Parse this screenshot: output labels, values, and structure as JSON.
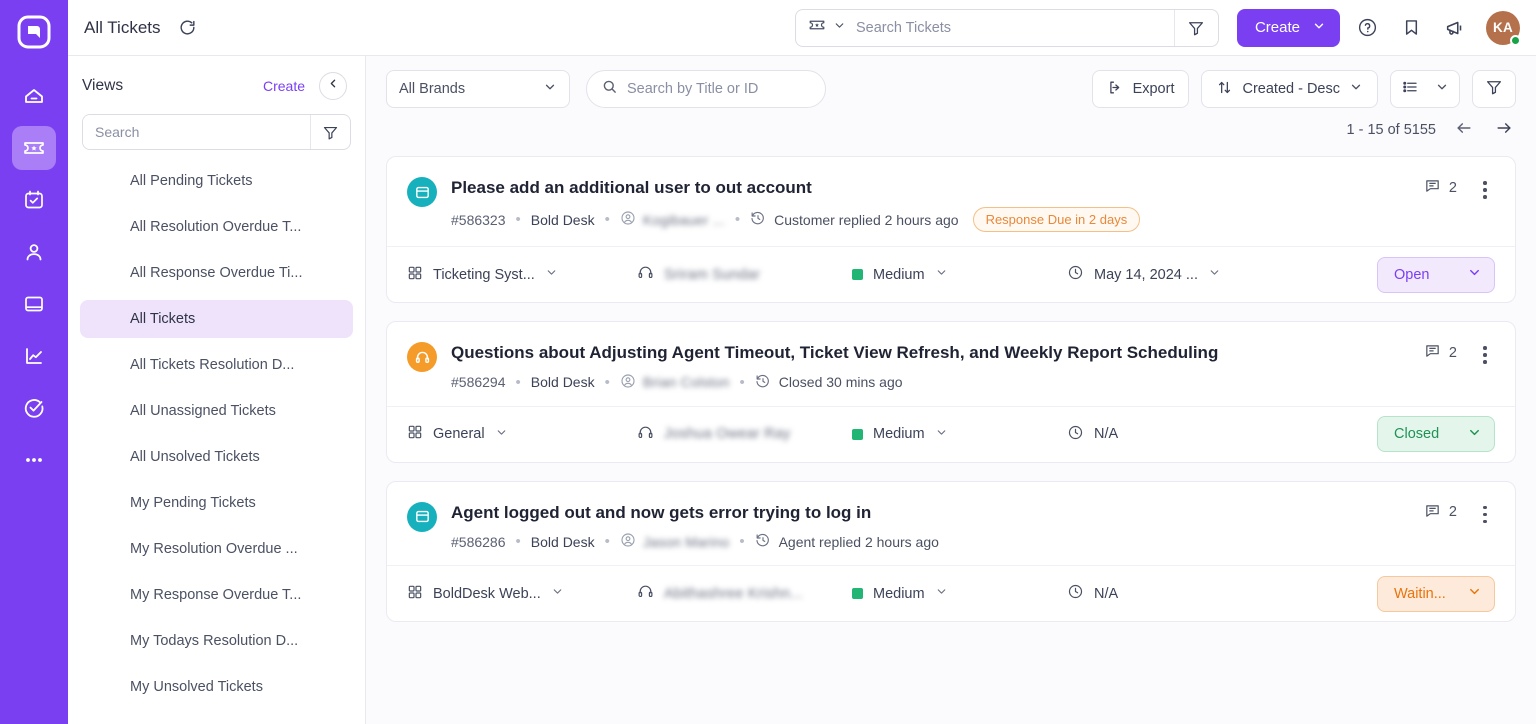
{
  "rail": {
    "logo": "boldesk-logo-icon",
    "items": [
      {
        "name": "home",
        "icon": "home-icon",
        "active": false
      },
      {
        "name": "tickets",
        "icon": "ticket-icon",
        "active": true
      },
      {
        "name": "tasks",
        "icon": "calendar-check-icon",
        "active": false
      },
      {
        "name": "contacts",
        "icon": "user-icon",
        "active": false
      },
      {
        "name": "knowledge-base",
        "icon": "book-icon",
        "active": false
      },
      {
        "name": "reports",
        "icon": "chart-line-icon",
        "active": false
      },
      {
        "name": "activities",
        "icon": "check-circle-icon",
        "active": false
      },
      {
        "name": "more",
        "icon": "ellipsis-icon",
        "active": false
      }
    ]
  },
  "header": {
    "title": "All Tickets",
    "refresh_icon": "refresh-icon",
    "search": {
      "type_icon": "ticket-icon",
      "placeholder": "Search Tickets",
      "value": "",
      "filter_icon": "filter-icon"
    },
    "create_label": "Create",
    "help_icon": "help-circle-icon",
    "bookmark_icon": "bookmark-icon",
    "announce_icon": "megaphone-icon",
    "avatar_initials": "KA",
    "avatar_color": "#b5714c",
    "status_dot_color": "#16a34a"
  },
  "views": {
    "title": "Views",
    "create_label": "Create",
    "collapse_icon": "chevron-left-icon",
    "search_placeholder": "Search",
    "search_value": "",
    "filter_icon": "filter-icon",
    "items": [
      {
        "label": "All Pending Tickets",
        "active": false
      },
      {
        "label": "All Resolution Overdue T...",
        "active": false
      },
      {
        "label": "All Response Overdue Ti...",
        "active": false
      },
      {
        "label": "All Tickets",
        "active": true
      },
      {
        "label": "All Tickets Resolution D...",
        "active": false
      },
      {
        "label": "All Unassigned Tickets",
        "active": false
      },
      {
        "label": "All Unsolved Tickets",
        "active": false
      },
      {
        "label": "My Pending Tickets",
        "active": false
      },
      {
        "label": "My Resolution Overdue ...",
        "active": false
      },
      {
        "label": "My Response Overdue T...",
        "active": false
      },
      {
        "label": "My Todays Resolution D...",
        "active": false
      },
      {
        "label": "My Unsolved Tickets",
        "active": false
      }
    ]
  },
  "toolbar": {
    "brand_value": "All Brands",
    "search_placeholder": "Search by Title or ID",
    "search_value": "",
    "export_label": "Export",
    "sort_label": "Created - Desc",
    "view_mode_icon": "list-view-icon",
    "filter_icon": "filter-icon",
    "pagination_text": "1 - 15 of 5155",
    "prev_icon": "arrow-left-icon",
    "next_icon": "arrow-right-icon"
  },
  "tickets": [
    {
      "type_icon": "window-icon",
      "type_color": "#17b1bd",
      "title": "Please add an additional user to out account",
      "id": "#586323",
      "brand": "Bold Desk",
      "requester": "Kogibauer ...",
      "activity": "Customer replied 2 hours ago",
      "badge": "Response Due in 2 days",
      "comments": "2",
      "category": "Ticketing Syst...",
      "agent": "Sriram Sundar",
      "priority": "Medium",
      "priority_color": "#22b573",
      "due": "May 14, 2024 ...",
      "status": "Open",
      "status_style": "st-open"
    },
    {
      "type_icon": "headset-icon",
      "type_color": "#f59b2a",
      "title": "Questions about Adjusting Agent Timeout, Ticket View Refresh, and Weekly Report Scheduling",
      "id": "#586294",
      "brand": "Bold Desk",
      "requester": "Brian Colston",
      "activity": "Closed 30 mins ago",
      "badge": "",
      "comments": "2",
      "category": "General",
      "agent": "Joshua Owear Ray",
      "priority": "Medium",
      "priority_color": "#22b573",
      "due": "N/A",
      "status": "Closed",
      "status_style": "st-closed"
    },
    {
      "type_icon": "window-icon",
      "type_color": "#17b1bd",
      "title": "Agent logged out and now gets error trying to log in",
      "id": "#586286",
      "brand": "Bold Desk",
      "requester": "Jason Marino",
      "activity": "Agent replied 2 hours ago",
      "badge": "",
      "comments": "2",
      "category": "BoldDesk Web...",
      "agent": "Abithashree Krishn...",
      "priority": "Medium",
      "priority_color": "#22b573",
      "due": "N/A",
      "status": "Waitin...",
      "status_style": "st-waiting"
    }
  ]
}
